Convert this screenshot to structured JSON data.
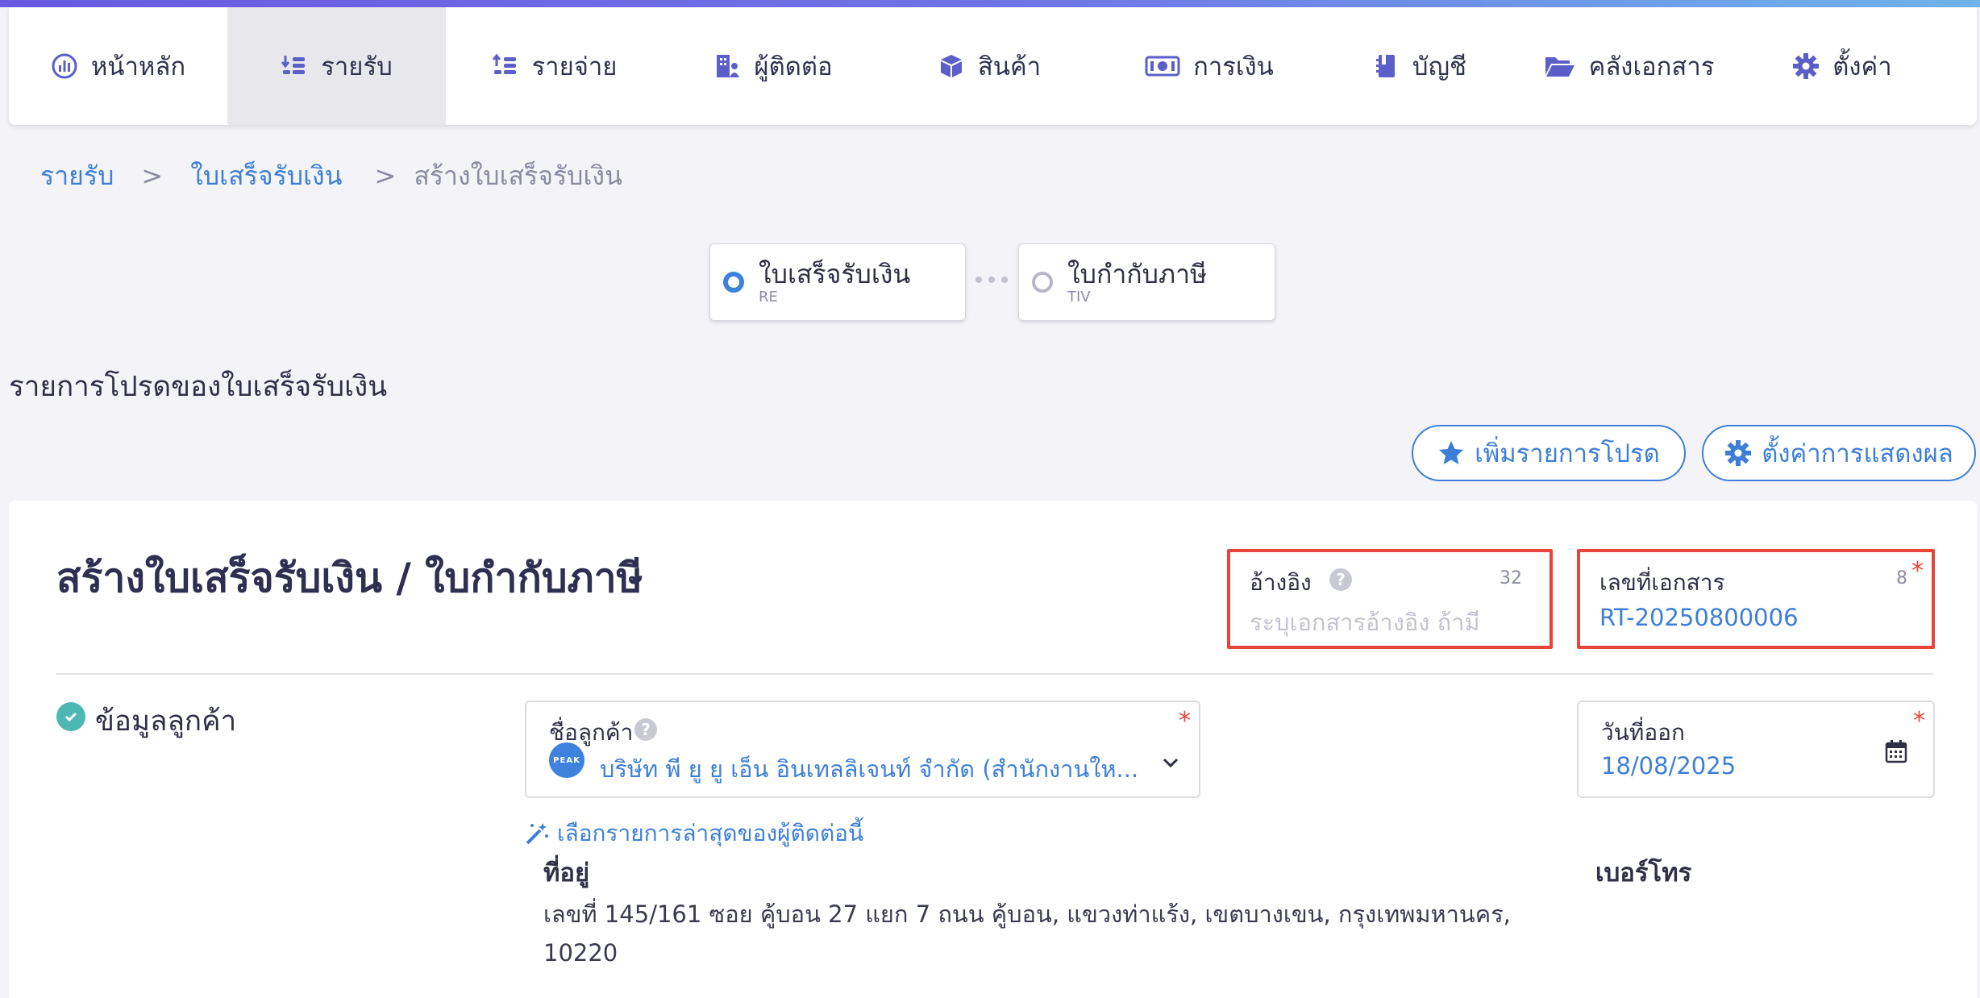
{
  "nav": {
    "items": [
      {
        "label": "หน้าหลัก",
        "icon": "dashboard-gauge-icon"
      },
      {
        "label": "รายรับ",
        "icon": "income-coins-icon"
      },
      {
        "label": "รายจ่าย",
        "icon": "expense-coins-icon"
      },
      {
        "label": "ผู้ติดต่อ",
        "icon": "contacts-building-icon"
      },
      {
        "label": "สินค้า",
        "icon": "product-box-icon"
      },
      {
        "label": "การเงิน",
        "icon": "money-bill-icon"
      },
      {
        "label": "บัญชี",
        "icon": "account-book-icon"
      },
      {
        "label": "คลังเอกสาร",
        "icon": "folder-open-icon"
      },
      {
        "label": "ตั้งค่า",
        "icon": "gear-icon"
      }
    ],
    "active_index": 1
  },
  "breadcrumb": {
    "items": [
      {
        "label": "รายรับ"
      },
      {
        "label": "ใบเสร็จรับเงิน"
      },
      {
        "label": "สร้างใบเสร็จรับเงิน"
      }
    ],
    "separator": ">"
  },
  "doc_steps": [
    {
      "name": "ใบเสร็จรับเงิน",
      "code": "RE",
      "selected": true
    },
    {
      "name": "ใบกำกับภาษี",
      "code": "TIV",
      "selected": false
    }
  ],
  "favorites": {
    "title": "รายการโปรดของใบเสร็จรับเงิน",
    "add_button": "เพิ่มรายการโปรด",
    "settings_button": "ตั้งค่าการแสดงผล"
  },
  "form": {
    "title": "สร้างใบเสร็จรับเงิน / ใบกำกับภาษี",
    "reference": {
      "label": "อ้างอิง",
      "max_length": "32",
      "placeholder": "ระบุเอกสารอ้างอิง ถ้ามี",
      "value": ""
    },
    "document_number": {
      "label": "เลขที่เอกสาร",
      "max_length": "8",
      "value": "RT-20250800006",
      "required": "*"
    },
    "customer_section": {
      "title": "ข้อมูลลูกค้า"
    },
    "customer_name": {
      "label": "ชื่อลูกค้า",
      "value": "บริษัท พี ยู ยู เอ็น อินเทลลิเจนท์ จำกัด (สำนักงานให...",
      "logo_text": "PEAK",
      "required": "*"
    },
    "issue_date": {
      "label": "วันที่ออก",
      "value": "18/08/2025",
      "required": "*"
    },
    "latest_contact_link": "เลือกรายการล่าสุดของผู้ติดต่อนี้",
    "address": {
      "label": "ที่อยู่",
      "line1": "เลขที่ 145/161 ซอย คู้บอน 27 แยก 7 ถนน คู้บอน, แขวงท่าแร้ง, เขตบางเขน, กรุงเทพมหานคร,",
      "line2": "10220"
    },
    "phone": {
      "label": "เบอร์โทร"
    }
  },
  "colors": {
    "accent_blue": "#3d7fd8",
    "highlight_red": "#e8453a",
    "check_teal": "#4db8b3",
    "nav_icon_purple": "#5b5fc7"
  }
}
